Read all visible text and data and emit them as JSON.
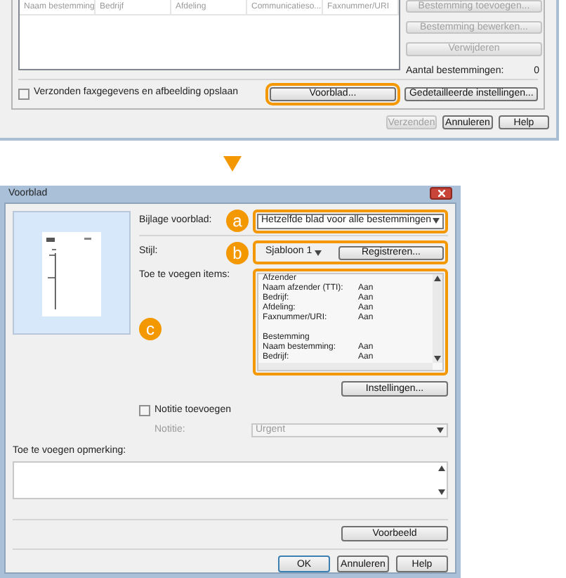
{
  "top_dialog": {
    "list_columns": [
      "Naam bestemming",
      "Bedrijf",
      "Afdeling",
      "Communicatieso...",
      "Faxnummer/URI"
    ],
    "side_buttons": [
      {
        "label": "Bestemming toevoegen...",
        "disabled": true
      },
      {
        "label": "Bestemming bewerken...",
        "disabled": true
      },
      {
        "label": "Verwijderen",
        "disabled": true
      }
    ],
    "destination_count": {
      "label": "Aantal bestemmingen:",
      "value": "0"
    },
    "save_checkbox": {
      "label": "Verzonden faxgegevens en afbeelding opslaan",
      "checked": false
    },
    "cover_button": {
      "label": "Voorblad...",
      "highlighted": true
    },
    "detail_button": {
      "label": "Gedetailleerde instellingen...",
      "highlighted": false
    },
    "footer_buttons": [
      {
        "label": "Verzenden",
        "disabled": true
      },
      {
        "label": "Annuleren",
        "disabled": false
      },
      {
        "label": "Help",
        "disabled": false
      }
    ]
  },
  "dialog": {
    "title": "Voorblad",
    "cover_attachment": {
      "label": "Bijlage voorblad:",
      "value": "Hetzelfde blad voor alle bestemmingen",
      "callout": "a"
    },
    "style": {
      "label": "Stijl:",
      "value": "Sjabloon 1",
      "register_button": "Registreren...",
      "callout": "b"
    },
    "items": {
      "label": "Toe te voegen items:",
      "callout": "c",
      "entries": [
        {
          "kind": "heading",
          "name": "Afzender"
        },
        {
          "kind": "item",
          "name": "Naam afzender (TTI):",
          "value": "Aan"
        },
        {
          "kind": "item",
          "name": "Bedrijf:",
          "value": "Aan"
        },
        {
          "kind": "item",
          "name": "Afdeling:",
          "value": "Aan"
        },
        {
          "kind": "item",
          "name": "Faxnummer/URI:",
          "value": "Aan"
        },
        {
          "kind": "heading",
          "name": "Bestemming"
        },
        {
          "kind": "item",
          "name": "Naam bestemming:",
          "value": "Aan"
        },
        {
          "kind": "item",
          "name": "Bedrijf:",
          "value": "Aan"
        }
      ]
    },
    "settings_button": "Instellingen...",
    "note": {
      "label": "Notitie toevoegen",
      "checked": false
    },
    "note_type": {
      "label": "Notitie:",
      "value": "Urgent",
      "disabled": true
    },
    "remark": {
      "label": "Toe te voegen opmerking:"
    },
    "preview_button": "Voorbeeld",
    "buttons": [
      {
        "label": "OK",
        "default": true
      },
      {
        "label": "Annuleren",
        "default": false
      },
      {
        "label": "Help",
        "default": false
      }
    ]
  }
}
